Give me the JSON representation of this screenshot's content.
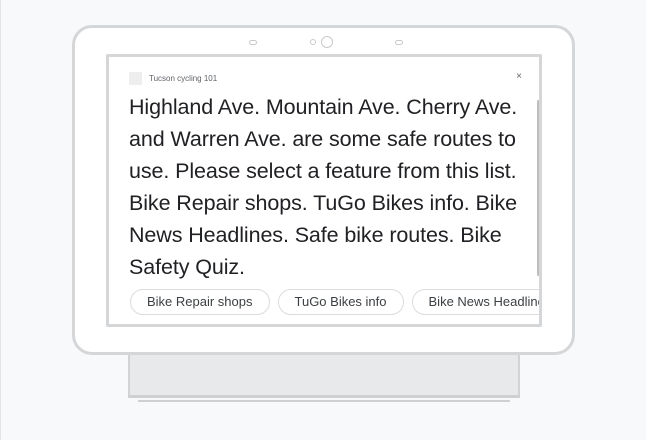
{
  "screen": {
    "app_title": "Tucson cycling 101",
    "close_label": "×",
    "response_text": "Highland Ave. Mountain Ave. Cherry Ave. and Warren Ave. are some safe routes to use. Please select a feature from this list. Bike Repair shops. TuGo Bikes info. Bike News Headlines. Safe bike routes. Bike Safety Quiz.",
    "suggestion_chips": [
      "Bike Repair shops",
      "TuGo Bikes info",
      "Bike News Headlines"
    ]
  },
  "colors": {
    "background": "#f8f9fa",
    "device_border": "#d5d6d8",
    "text_primary": "#202124",
    "text_secondary": "#5f6368",
    "chip_border": "#dadce0"
  },
  "icons": {
    "app_icon": "app-icon",
    "close_icon": "close-icon"
  }
}
